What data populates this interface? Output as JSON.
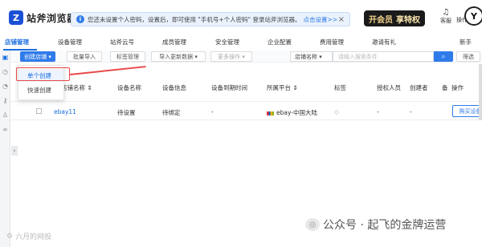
{
  "header": {
    "logo_mark": "Z",
    "app_name": "站斧浏览器",
    "notice_text": "您还未设置个人密码，设置后，即可使用 \"手机号+个人密码\" 登录站斧浏览器。",
    "notice_link": "点击设置>>",
    "notice_close": "×",
    "vip_label": "开会员",
    "vip_sub": "享特权",
    "service_label": "客服",
    "ops_label": "操作"
  },
  "nav": {
    "items": [
      "店铺管理",
      "设备管理",
      "站斧云号",
      "成员管理",
      "安全管理",
      "企业配置",
      "费用管理",
      "邀请有礼",
      "新手"
    ]
  },
  "toolbar": {
    "create_shop": "创建店铺 ▾",
    "batch_import": "批量导入",
    "tag_manage": "标签管理",
    "import_update": "导入更新数据 ▾",
    "more_ops": "更多操作 ▾",
    "shop_name_select": "店铺名称 ▾",
    "search_placeholder": "请输入搜索条件",
    "search_icon": "search-icon",
    "filter": "筛选"
  },
  "dropdown": {
    "single_create": "单个创建",
    "quick_create": "快速创建"
  },
  "table": {
    "columns": [
      "店铺名称 ⇕",
      "设备名称",
      "设备信息",
      "设备到期时间",
      "所属平台 ⇕",
      "标签",
      "授权人员",
      "创建者",
      "备",
      "操作"
    ],
    "rows": [
      {
        "shop": "ebay11",
        "device": "待设置",
        "device_info": "待绑定",
        "expire": "-",
        "platform": "ebay-中国大陆",
        "tag": "◇",
        "auth": "-",
        "creator": "-",
        "action": "购买设备"
      }
    ]
  },
  "watermark": {
    "text": "公众号 · 起飞的金牌运营",
    "bottom_left": "六月的网投"
  },
  "colors": {
    "accent": "#1b6fe0",
    "primary_button": "#2f7bea",
    "highlight_red": "#e94848"
  }
}
